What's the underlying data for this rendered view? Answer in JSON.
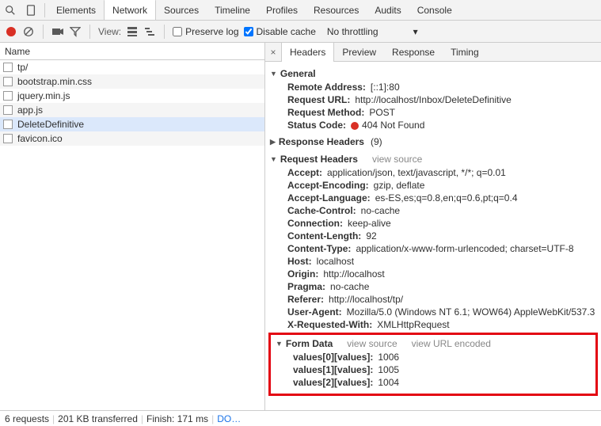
{
  "tabs": [
    "Elements",
    "Network",
    "Sources",
    "Timeline",
    "Profiles",
    "Resources",
    "Audits",
    "Console"
  ],
  "active_tab": "Network",
  "toolbar": {
    "view_label": "View:",
    "preserve_log": "Preserve log",
    "disable_cache": "Disable cache",
    "throttling": "No throttling"
  },
  "name_header": "Name",
  "requests": [
    {
      "name": "tp/",
      "type": "doc"
    },
    {
      "name": "bootstrap.min.css",
      "type": "file"
    },
    {
      "name": "jquery.min.js",
      "type": "file"
    },
    {
      "name": "app.js",
      "type": "file"
    },
    {
      "name": "DeleteDefinitive",
      "type": "file",
      "selected": true
    },
    {
      "name": "favicon.ico",
      "type": "file"
    }
  ],
  "subtabs": [
    "Headers",
    "Preview",
    "Response",
    "Timing"
  ],
  "active_subtab": "Headers",
  "general": {
    "title": "General",
    "remote_address_k": "Remote Address:",
    "remote_address_v": "[::1]:80",
    "request_url_k": "Request URL:",
    "request_url_v": "http://localhost/Inbox/DeleteDefinitive",
    "request_method_k": "Request Method:",
    "request_method_v": "POST",
    "status_code_k": "Status Code:",
    "status_code_v": "404 Not Found"
  },
  "response_headers": {
    "title": "Response Headers",
    "count": "(9)"
  },
  "request_headers": {
    "title": "Request Headers",
    "view_source": "view source",
    "items": [
      {
        "k": "Accept:",
        "v": "application/json, text/javascript, */*; q=0.01"
      },
      {
        "k": "Accept-Encoding:",
        "v": "gzip, deflate"
      },
      {
        "k": "Accept-Language:",
        "v": "es-ES,es;q=0.8,en;q=0.6,pt;q=0.4"
      },
      {
        "k": "Cache-Control:",
        "v": "no-cache"
      },
      {
        "k": "Connection:",
        "v": "keep-alive"
      },
      {
        "k": "Content-Length:",
        "v": "92"
      },
      {
        "k": "Content-Type:",
        "v": "application/x-www-form-urlencoded; charset=UTF-8"
      },
      {
        "k": "Host:",
        "v": "localhost"
      },
      {
        "k": "Origin:",
        "v": "http://localhost"
      },
      {
        "k": "Pragma:",
        "v": "no-cache"
      },
      {
        "k": "Referer:",
        "v": "http://localhost/tp/"
      },
      {
        "k": "User-Agent:",
        "v": "Mozilla/5.0 (Windows NT 6.1; WOW64) AppleWebKit/537.3"
      },
      {
        "k": "X-Requested-With:",
        "v": "XMLHttpRequest"
      }
    ]
  },
  "form_data": {
    "title": "Form Data",
    "view_source": "view source",
    "view_url": "view URL encoded",
    "items": [
      {
        "k": "values[0][values]:",
        "v": "1006"
      },
      {
        "k": "values[1][values]:",
        "v": "1005"
      },
      {
        "k": "values[2][values]:",
        "v": "1004"
      }
    ]
  },
  "footer": {
    "requests": "6 requests",
    "transferred": "201 KB transferred",
    "finish": "Finish: 171 ms",
    "dom": "DO…"
  }
}
